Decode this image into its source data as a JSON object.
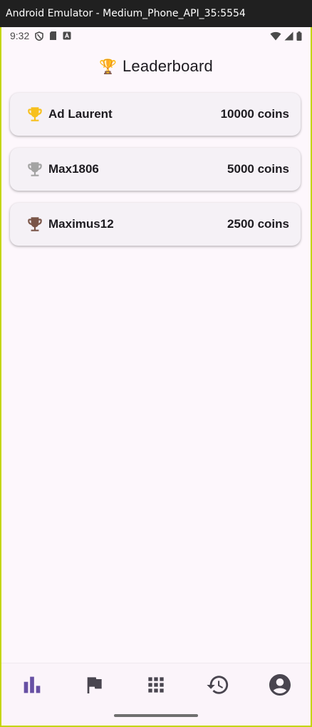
{
  "window": {
    "title": "Android Emulator - Medium_Phone_API_35:5554"
  },
  "status_bar": {
    "time": "9:32"
  },
  "header": {
    "emoji": "🏆",
    "title": "Leaderboard"
  },
  "leaderboard": [
    {
      "name": "Ad Laurent",
      "coins": "10000 coins",
      "trophy_color": "#f7c01e"
    },
    {
      "name": "Max1806",
      "coins": "5000 coins",
      "trophy_color": "#a3a3a3"
    },
    {
      "name": "Maximus12",
      "coins": "2500 coins",
      "trophy_color": "#7a5548"
    }
  ],
  "bottom_nav": {
    "active_color": "#6750a4",
    "inactive_color": "#49454f",
    "items": [
      {
        "icon": "leaderboard-icon",
        "active": true
      },
      {
        "icon": "flag-icon",
        "active": false
      },
      {
        "icon": "apps-grid-icon",
        "active": false
      },
      {
        "icon": "history-icon",
        "active": false
      },
      {
        "icon": "account-circle-icon",
        "active": false
      }
    ]
  }
}
